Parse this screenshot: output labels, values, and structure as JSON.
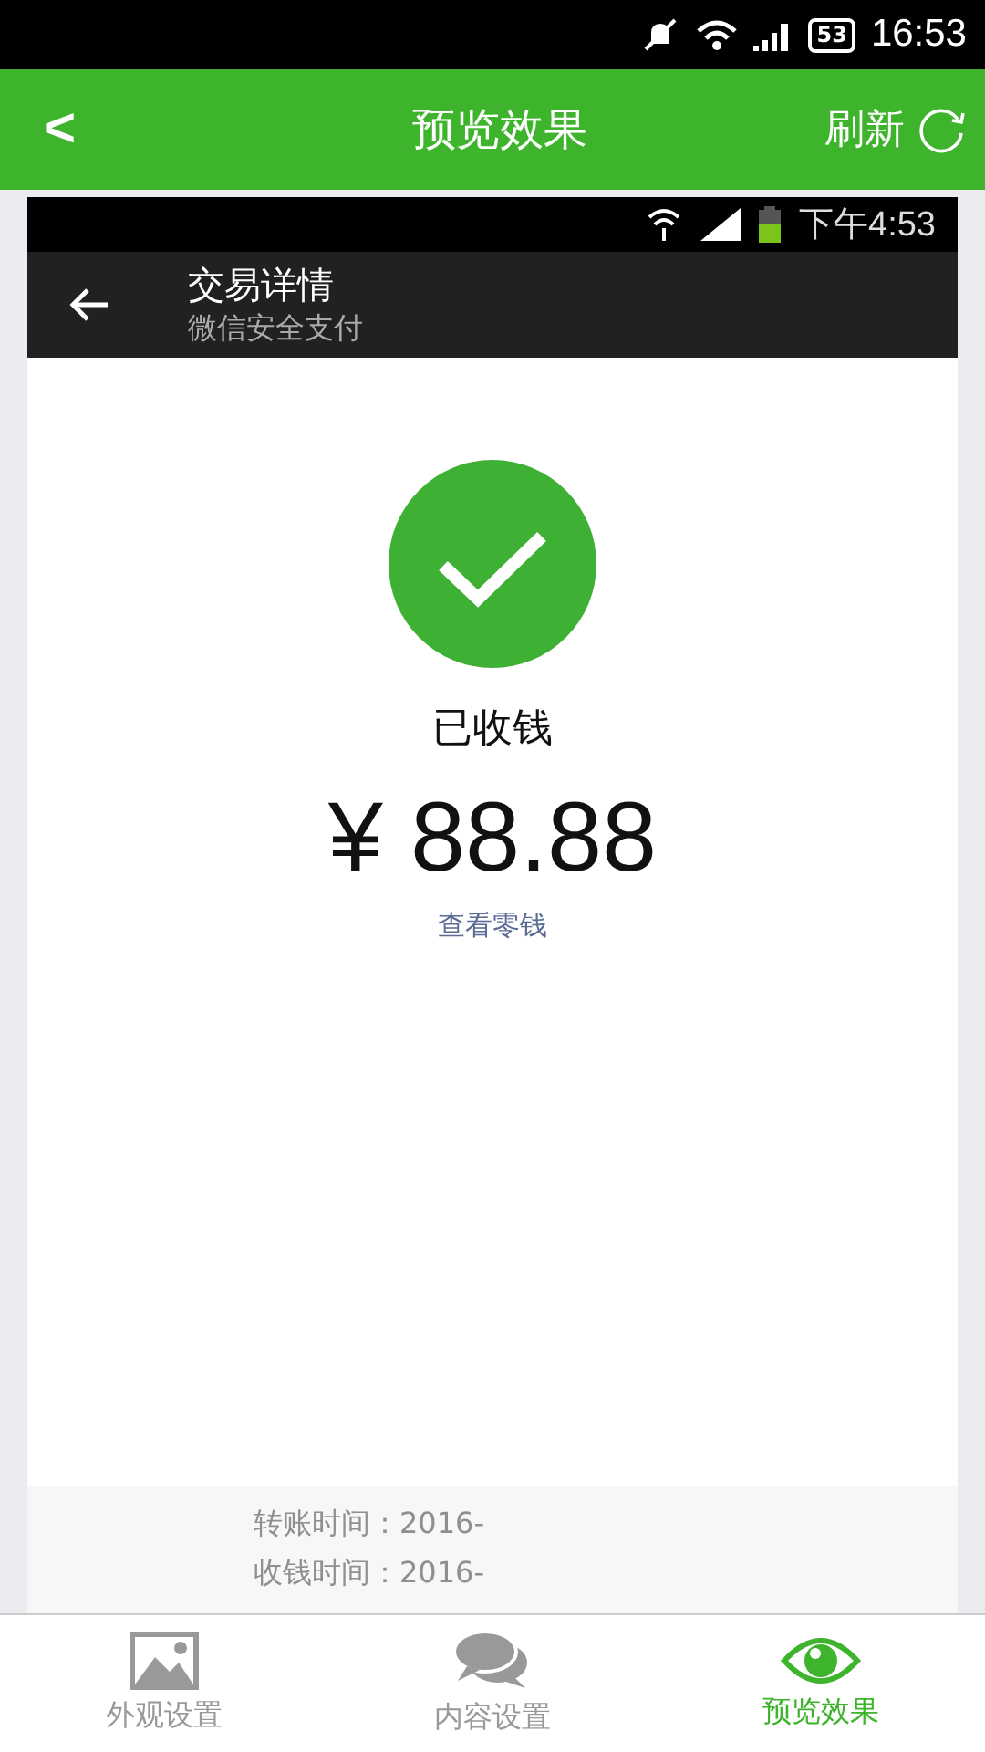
{
  "status_bar": {
    "battery": "53",
    "time": "16:53"
  },
  "header": {
    "back": "<",
    "title": "预览效果",
    "action": "刷新"
  },
  "preview": {
    "status_bar": {
      "time": "下午4:53"
    },
    "header": {
      "title": "交易详情",
      "subtitle": "微信安全支付"
    },
    "status": "已收钱",
    "amount": "¥ 88.88",
    "link": "查看零钱",
    "details": [
      {
        "label": "转账时间：2016-"
      },
      {
        "label": "收钱时间：2016-"
      }
    ]
  },
  "tabs": [
    {
      "label": "外观设置",
      "kind": "picture",
      "selected": false
    },
    {
      "label": "内容设置",
      "kind": "chat",
      "selected": false
    },
    {
      "label": "预览效果",
      "kind": "eye",
      "selected": true
    }
  ]
}
